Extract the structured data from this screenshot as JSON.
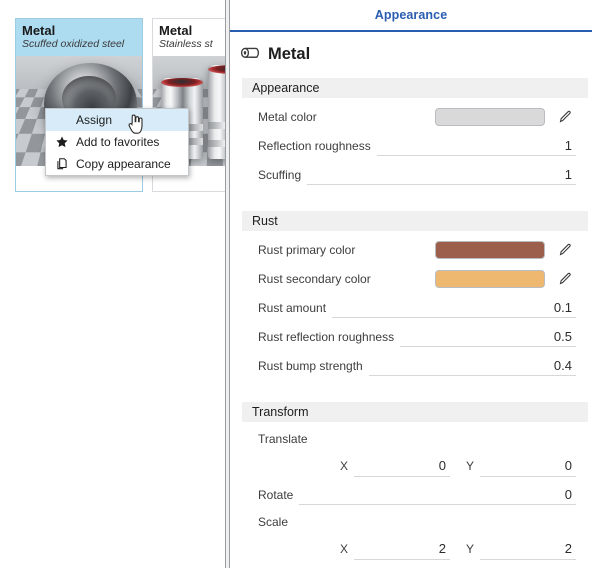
{
  "library": {
    "cards": [
      {
        "title": "Metal",
        "subtitle": "Scuffed oxidized steel",
        "selected": true,
        "thumb": "torus-scuffed-steel-render"
      },
      {
        "title": "Metal",
        "subtitle": "Stainless st",
        "selected": false,
        "thumb": "stainless-cans-render"
      }
    ]
  },
  "context_menu": {
    "items": [
      {
        "label": "Assign",
        "icon": "",
        "highlight": true
      },
      {
        "label": "Add to favorites",
        "icon": "star-icon",
        "highlight": false
      },
      {
        "label": "Copy appearance",
        "icon": "copy-icon",
        "highlight": false
      }
    ]
  },
  "cursor": {
    "type": "pointing-hand-cursor"
  },
  "properties": {
    "tab_label": "Appearance",
    "tab_accent": "#2a5db0",
    "title": "Metal",
    "title_icon": "material-roll-icon",
    "sections": [
      {
        "name": "Appearance",
        "rows": [
          {
            "kind": "color",
            "label": "Metal color",
            "value": "#d9d9d9",
            "edit_icon": "pencil-icon"
          },
          {
            "kind": "number",
            "label": "Reflection roughness",
            "value": "1"
          },
          {
            "kind": "number",
            "label": "Scuffing",
            "value": "1"
          }
        ]
      },
      {
        "name": "Rust",
        "rows": [
          {
            "kind": "color",
            "label": "Rust primary color",
            "value": "#9c5f4c",
            "edit_icon": "pencil-icon"
          },
          {
            "kind": "color",
            "label": "Rust secondary color",
            "value": "#eeb870",
            "edit_icon": "pencil-icon"
          },
          {
            "kind": "number",
            "label": "Rust amount",
            "value": "0.1"
          },
          {
            "kind": "number",
            "label": "Rust reflection roughness",
            "value": "0.5"
          },
          {
            "kind": "number",
            "label": "Rust bump strength",
            "value": "0.4"
          }
        ]
      },
      {
        "name": "Transform",
        "rows": [
          {
            "kind": "sublabel",
            "label": "Translate"
          },
          {
            "kind": "xy",
            "x_label": "X",
            "x_value": "0",
            "y_label": "Y",
            "y_value": "0"
          },
          {
            "kind": "number",
            "label": "Rotate",
            "value": "0"
          },
          {
            "kind": "sublabel",
            "label": "Scale"
          },
          {
            "kind": "xy",
            "x_label": "X",
            "x_value": "2",
            "y_label": "Y",
            "y_value": "2"
          }
        ]
      }
    ]
  }
}
